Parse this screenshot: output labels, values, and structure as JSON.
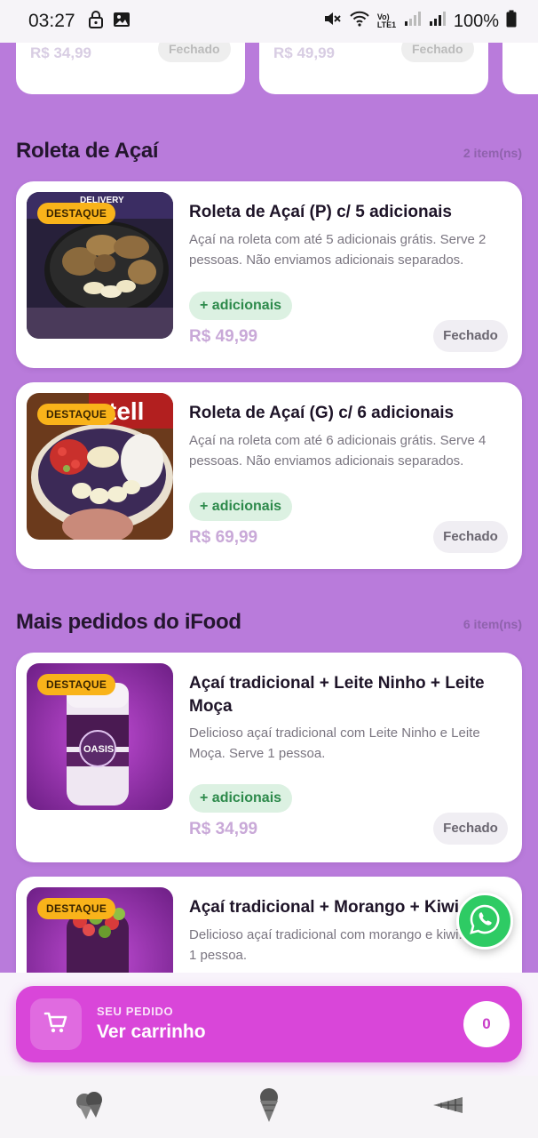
{
  "status_bar": {
    "time": "03:27",
    "network_label": "Vo) LTE1",
    "battery": "100%"
  },
  "top_row_partial": [
    {
      "price": "R$ 34,99",
      "button": "Fechado"
    },
    {
      "price": "R$ 49,99",
      "button": "Fechado"
    }
  ],
  "sections": [
    {
      "title": "Roleta de Açaí",
      "count": "2 item(ns)",
      "products": [
        {
          "badge": "DESTAQUE",
          "name": "Roleta de Açaí (P) c/ 5 adicionais",
          "description": "Açaí na roleta com até 5 adicionais grátis. Serve 2 pessoas. Não enviamos adicionais separados.",
          "addons": "+ adicionais",
          "price": "R$ 49,99",
          "status": "Fechado"
        },
        {
          "badge": "DESTAQUE",
          "name": "Roleta de Açaí (G) c/ 6 adicionais",
          "description": "Açaí na roleta com até 6 adicionais grátis. Serve 4 pessoas. Não enviamos adicionais separados.",
          "addons": "+ adicionais",
          "price": "R$ 69,99",
          "status": "Fechado"
        }
      ]
    },
    {
      "title": "Mais pedidos do iFood",
      "count": "6 item(ns)",
      "products": [
        {
          "badge": "DESTAQUE",
          "name": "Açaí tradicional + Leite Ninho + Leite Moça",
          "description": "Delicioso açaí tradicional com Leite Ninho e Leite Moça. Serve 1 pessoa.",
          "addons": "+ adicionais",
          "price": "R$ 34,99",
          "status": "Fechado"
        },
        {
          "badge": "DESTAQUE",
          "name": "Açaí tradicional + Morango + Kiwi",
          "description": "Delicioso açaí tradicional com morango e kiwi. Serve 1 pessoa."
        }
      ]
    }
  ],
  "cart": {
    "label": "SEU PEDIDO",
    "title": "Ver carrinho",
    "count": "0"
  },
  "colors": {
    "background": "#b97bdb",
    "cart": "#d946d9",
    "badge": "#f9b31a",
    "addons_bg": "#dcf1e2",
    "addons_text": "#2d8a4b",
    "price": "#c9a9d8",
    "whatsapp": "#2ecb64"
  },
  "icons": [
    "lock-icon",
    "image-icon",
    "mute-icon",
    "wifi-icon",
    "signal-icon",
    "battery-icon",
    "cart-icon",
    "whatsapp-icon",
    "ice-cream-scoops-icon",
    "ice-cream-cone-icon",
    "waffle-cone-icon"
  ]
}
